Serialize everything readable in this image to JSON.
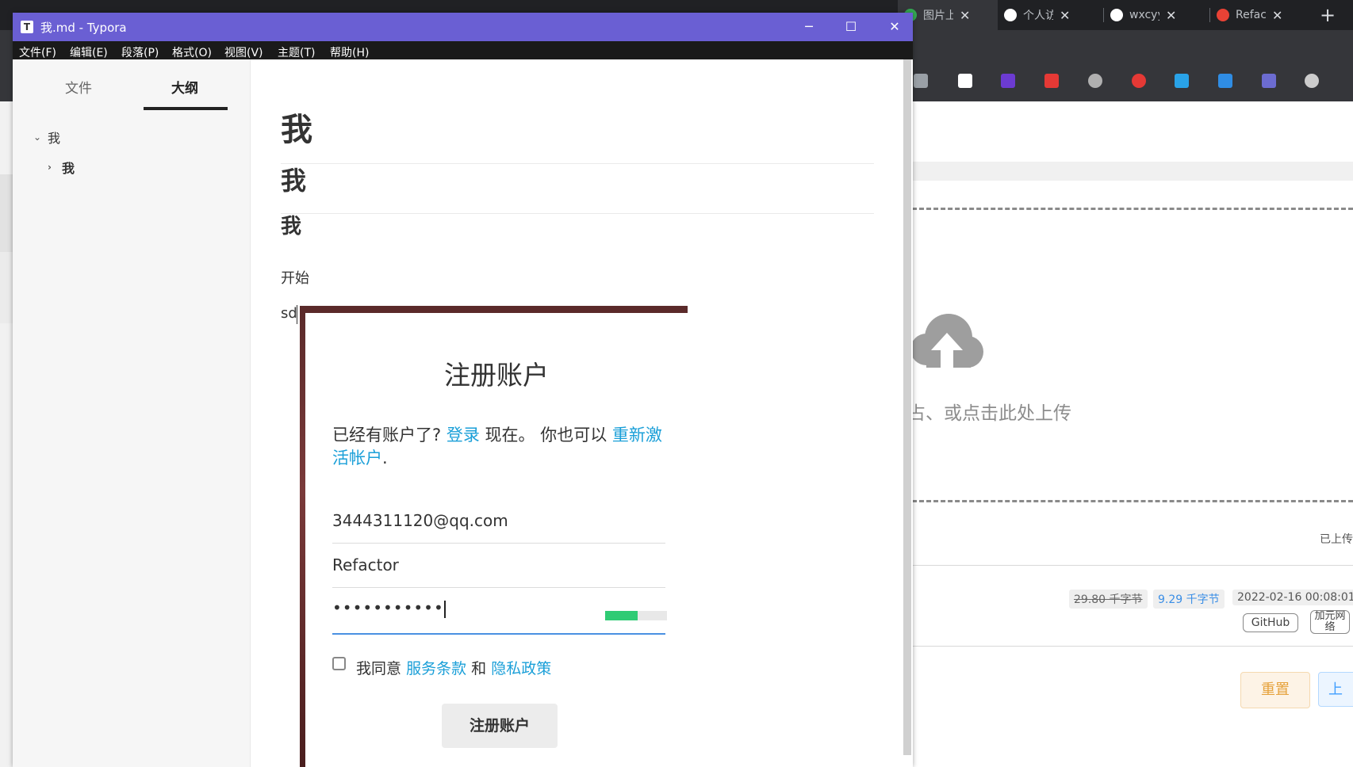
{
  "browser": {
    "tabs": [
      {
        "label": "图片上传",
        "icon_color": "#34a853",
        "active": true
      },
      {
        "label": "个人访问",
        "icon_color": "#ffffff",
        "active": false
      },
      {
        "label": "wxcyyy",
        "icon_color": "#ffffff",
        "active": false
      },
      {
        "label": "Refactor",
        "icon_color": "#e94235",
        "active": false
      }
    ],
    "bookmark_icons": [
      "book-icon",
      "letter-l-icon",
      "play-icon",
      "clapper-icon",
      "mask-icon",
      "record-icon",
      "pen-icon",
      "image-icon",
      "text-icon",
      "puzzle-icon"
    ],
    "bookmark_colors": [
      "#9aa0a6",
      "#ffffff",
      "#6c3bd1",
      "#e53935",
      "#b0b0b0",
      "#e53935",
      "#29a3e8",
      "#2f8de4",
      "#6c6cd1",
      "#cccccc"
    ]
  },
  "upload_panel": {
    "hint": "占、或点击此处上传",
    "uploaded_label": "已上传",
    "size_old": "29.80 千字节",
    "size_new": "9.29 千字节",
    "date": "2022-02-16 00:08:01",
    "tag_github": "GitHub",
    "tag_addnet": "加元网络",
    "reset_button": "重置",
    "upload_button": "上"
  },
  "typora": {
    "title": "我.md - Typora",
    "app_icon": "T",
    "menu": [
      "文件(F)",
      "编辑(E)",
      "段落(P)",
      "格式(O)",
      "视图(V)",
      "主题(T)",
      "帮助(H)"
    ],
    "sidebar_tabs": {
      "files": "文件",
      "outline": "大纲"
    },
    "outline": [
      {
        "label": "我",
        "level": 1,
        "chevron": "⌄"
      },
      {
        "label": "我",
        "level": 2,
        "chevron": "›"
      }
    ],
    "doc": {
      "h1": "我",
      "h2": "我",
      "h3": "我",
      "p1": "开始",
      "p2": "sd"
    }
  },
  "signup": {
    "title": "注册账户",
    "hint_prefix": "已经有账户了?",
    "login_link": "登录",
    "hint_mid": "现在。 你也可以",
    "reactivate_link": "重新激活帐户",
    "hint_suffix": ".",
    "email": "3444311120@qq.com",
    "username": "Refactor",
    "password": "•••••••••••",
    "password_strength": 0.52,
    "agree_prefix": "我同意",
    "terms_link": "服务条款",
    "and_text": "和",
    "privacy_link": "隐私政策",
    "submit": "注册账户"
  }
}
